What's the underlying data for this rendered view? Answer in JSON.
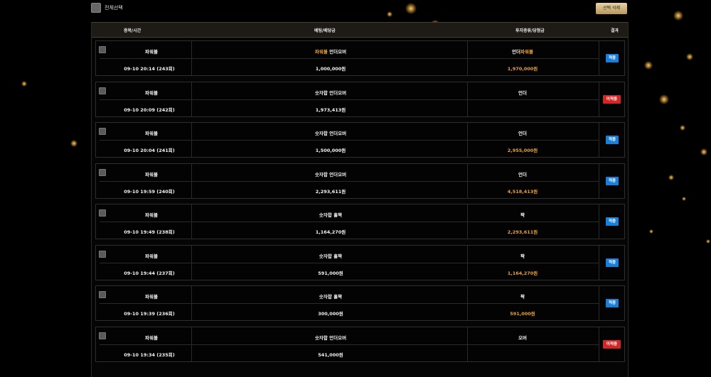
{
  "toolbar": {
    "select_all_label": "전체선택",
    "delete_selected_label": "선택 삭제"
  },
  "table": {
    "headers": {
      "game_time": "종목/시간",
      "bet_amount": "베팅/배당금",
      "pick_win": "투자종류/당첨금",
      "result": "결과"
    }
  },
  "colors": {
    "accent_gold": "#e8a23a",
    "hit_badge": "#1a7fd8",
    "miss_badge": "#d62525",
    "background": "#000000"
  },
  "rows": [
    {
      "game": "파워볼",
      "time": "09-10 20:14 (243회)",
      "bet_prefix": "파워볼",
      "bet": "언더오버",
      "amount": "1,000,000원",
      "pick_plain": "언더",
      "pick_gold": "파워볼",
      "win": "1,970,000원",
      "result": "적중"
    },
    {
      "game": "파워볼",
      "time": "09-10 20:09 (242회)",
      "bet_prefix": "",
      "bet": "숫자합 언더오버",
      "amount": "1,973,413원",
      "pick_plain": "언더",
      "pick_gold": "",
      "win": "",
      "result": "미적중"
    },
    {
      "game": "파워볼",
      "time": "09-10 20:04 (241회)",
      "bet_prefix": "",
      "bet": "숫자합 언더오버",
      "amount": "1,500,000원",
      "pick_plain": "언더",
      "pick_gold": "",
      "win": "2,955,000원",
      "result": "적중"
    },
    {
      "game": "파워볼",
      "time": "09-10 19:59 (240회)",
      "bet_prefix": "",
      "bet": "숫자합 언더오버",
      "amount": "2,293,611원",
      "pick_plain": "언더",
      "pick_gold": "",
      "win": "4,518,413원",
      "result": "적중"
    },
    {
      "game": "파워볼",
      "time": "09-10 19:49 (238회)",
      "bet_prefix": "",
      "bet": "숫자합 홀짝",
      "amount": "1,164,270원",
      "pick_plain": "짝",
      "pick_gold": "",
      "win": "2,293,611원",
      "result": "적중"
    },
    {
      "game": "파워볼",
      "time": "09-10 19:44 (237회)",
      "bet_prefix": "",
      "bet": "숫자합 홀짝",
      "amount": "591,000원",
      "pick_plain": "짝",
      "pick_gold": "",
      "win": "1,164,270원",
      "result": "적중"
    },
    {
      "game": "파워볼",
      "time": "09-10 19:39 (236회)",
      "bet_prefix": "",
      "bet": "숫자합 홀짝",
      "amount": "300,000원",
      "pick_plain": "짝",
      "pick_gold": "",
      "win": "591,000원",
      "result": "적중"
    },
    {
      "game": "파워볼",
      "time": "09-10 19:34 (235회)",
      "bet_prefix": "",
      "bet": "숫자합 언더오버",
      "amount": "541,000원",
      "pick_plain": "오버",
      "pick_gold": "",
      "win": "",
      "result": "미적중"
    }
  ]
}
